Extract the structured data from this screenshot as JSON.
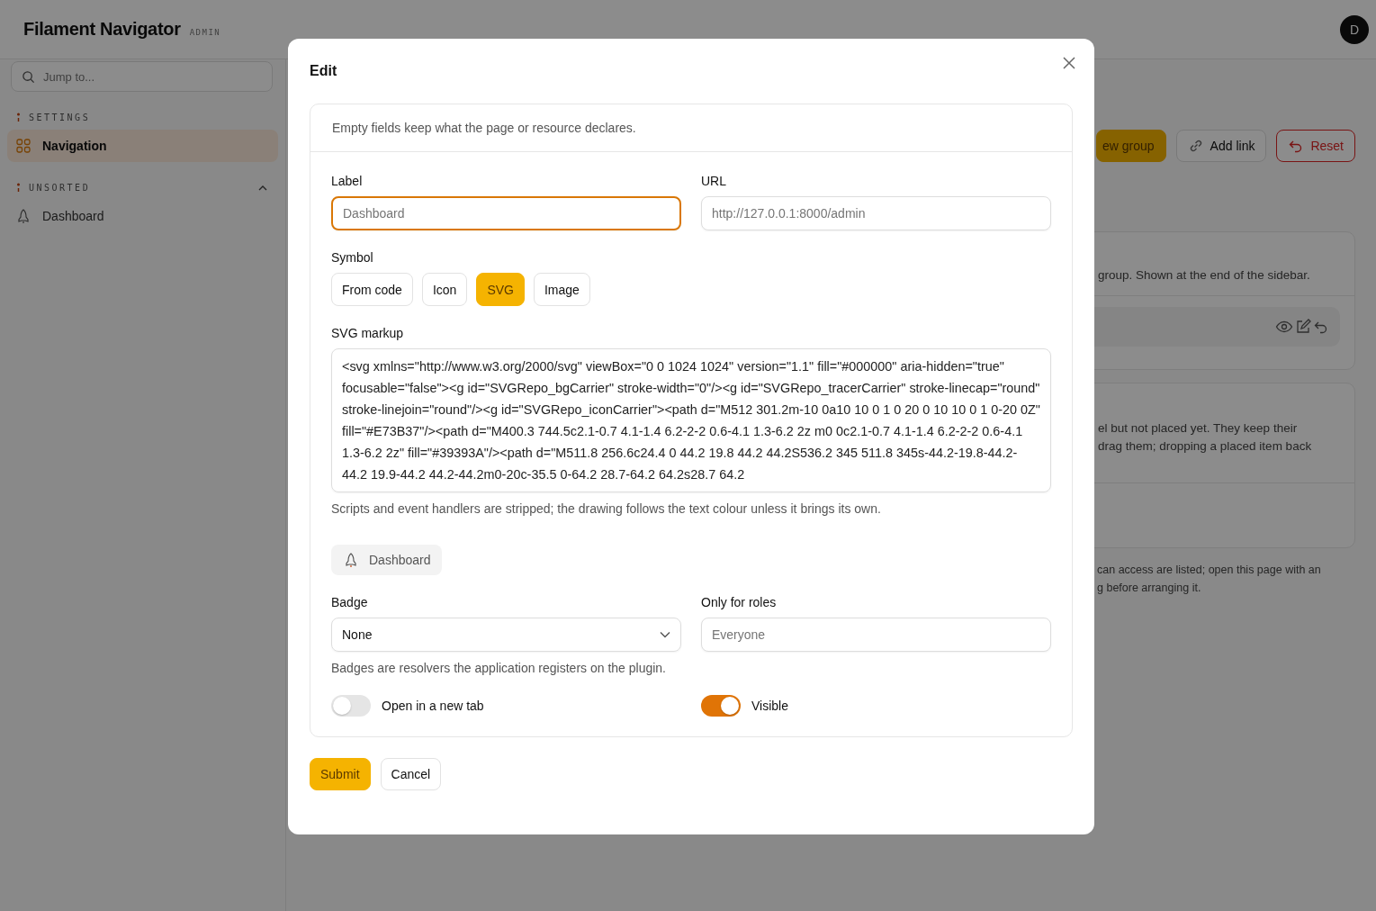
{
  "header": {
    "brand": "Filament Navigator",
    "panel": "ADMIN",
    "avatar": "D"
  },
  "sidebar": {
    "search_placeholder": "Jump to...",
    "groups": [
      {
        "title": "SETTINGS",
        "items": [
          {
            "label": "Navigation",
            "selected": true
          }
        ]
      },
      {
        "title": "UNSORTED",
        "expanded": true,
        "items": [
          {
            "label": "Dashboard",
            "selected": false
          }
        ]
      }
    ]
  },
  "page": {
    "actions": [
      {
        "label": "ew group",
        "kind": "primary"
      },
      {
        "label": "Add link",
        "kind": "link"
      },
      {
        "label": "Reset",
        "kind": "danger"
      }
    ],
    "card_1_text": "group. Shown at the end of the sidebar.",
    "card_2_text": "el but not placed yet. They keep their\ndrag them; dropping a placed item back",
    "footer_text": "can access are listed; open this page with an\ng before arranging it."
  },
  "modal": {
    "title": "Edit",
    "intro": "Empty fields keep what the page or resource declares.",
    "label_field": {
      "label": "Label",
      "placeholder": "Dashboard",
      "focused": true
    },
    "url_field": {
      "label": "URL",
      "placeholder": "http://127.0.0.1:8000/admin"
    },
    "symbol": {
      "label": "Symbol",
      "options": [
        {
          "label": "From code",
          "selected": false
        },
        {
          "label": "Icon",
          "selected": false
        },
        {
          "label": "SVG",
          "selected": true
        },
        {
          "label": "Image",
          "selected": false
        }
      ]
    },
    "svg_markup": {
      "label": "SVG markup",
      "value": "<svg xmlns=\"http://www.w3.org/2000/svg\" viewBox=\"0 0 1024 1024\" version=\"1.1\" fill=\"#000000\" aria-hidden=\"true\" focusable=\"false\"><g id=\"SVGRepo_bgCarrier\" stroke-width=\"0\"/><g id=\"SVGRepo_tracerCarrier\" stroke-linecap=\"round\" stroke-linejoin=\"round\"/><g id=\"SVGRepo_iconCarrier\"><path d=\"M512 301.2m-10 0a10 10 0 1 0 20 0 10 10 0 1 0-20 0Z\" fill=\"#E73B37\"/><path d=\"M400.3 744.5c2.1-0.7 4.1-1.4 6.2-2-2 0.6-4.1 1.3-6.2 2z m0 0c2.1-0.7 4.1-1.4 6.2-2-2 0.6-4.1 1.3-6.2 2z\" fill=\"#39393A\"/><path d=\"M511.8 256.6c24.4 0 44.2 19.8 44.2 44.2S536.2 345 511.8 345s-44.2-19.8-44.2-44.2 19.9-44.2 44.2-44.2m0-20c-35.5 0-64.2 28.7-64.2 64.2s28.7 64.2",
      "help": "Scripts and event handlers are stripped; the drawing follows the text colour unless it brings its own."
    },
    "preview": {
      "label": "Dashboard"
    },
    "badge": {
      "label": "Badge",
      "value": "None",
      "help": "Badges are resolvers the application registers on the plugin."
    },
    "roles": {
      "label": "Only for roles",
      "placeholder": "Everyone"
    },
    "toggles": [
      {
        "label": "Open in a new tab",
        "on": false
      },
      {
        "label": "Visible",
        "on": true
      }
    ],
    "buttons": [
      {
        "label": "Submit",
        "kind": "primary"
      },
      {
        "label": "Cancel",
        "kind": "secondary"
      }
    ]
  }
}
